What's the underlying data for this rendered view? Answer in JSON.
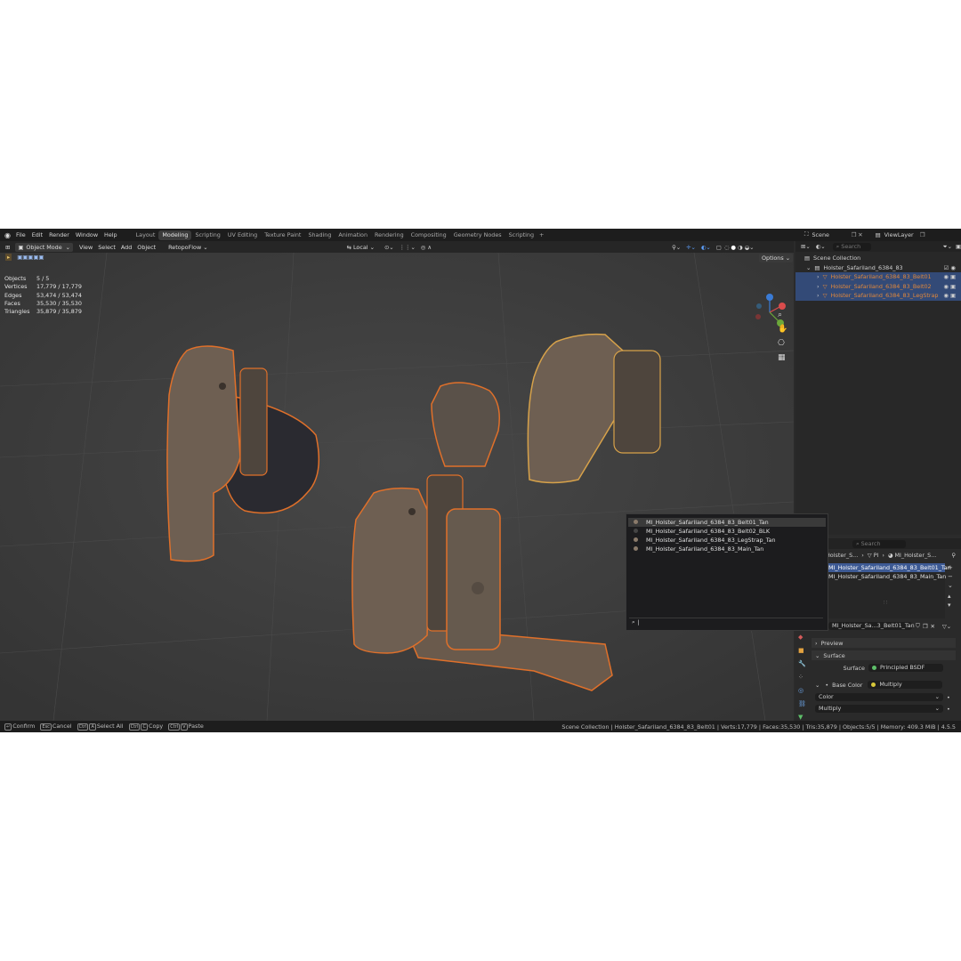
{
  "menu": [
    "File",
    "Edit",
    "Render",
    "Window",
    "Help"
  ],
  "workspaces": [
    "Layout",
    "Modeling",
    "Scripting",
    "UV Editing",
    "Texture Paint",
    "Shading",
    "Animation",
    "Rendering",
    "Compositing",
    "Geometry Nodes",
    "Scripting"
  ],
  "active_workspace": "Modeling",
  "scene_label": "Scene",
  "view_layer_label": "ViewLayer",
  "viewport_header": {
    "mode": "Object Mode",
    "menus": [
      "View",
      "Select",
      "Add",
      "Object"
    ],
    "addon": "RetopoFlow",
    "transform_space": "Local",
    "options": "Options"
  },
  "stats": {
    "objects_label": "Objects",
    "objects": "5 / 5",
    "vertices_label": "Vertices",
    "vertices": "17,779 / 17,779",
    "edges_label": "Edges",
    "edges": "53,474 / 53,474",
    "faces_label": "Faces",
    "faces": "35,530 / 35,530",
    "triangles_label": "Triangles",
    "triangles": "35,879 / 35,879"
  },
  "outliner": {
    "search_placeholder": "Search",
    "scene_collection": "Scene Collection",
    "collection": "Holster_Safariland_6384_83",
    "objects": [
      "Holster_Safariland_6384_83_Belt01",
      "Holster_Safariland_6384_83_Belt02",
      "Holster_Safariland_6384_83_LegStrap"
    ]
  },
  "material_popup": {
    "items": [
      "MI_Holster_Safariland_6384_83_Belt01_Tan",
      "MI_Holster_Safariland_6384_83_Belt02_BLK",
      "MI_Holster_Safariland_6384_83_LegStrap_Tan",
      "MI_Holster_Safariland_6384_83_Main_Tan"
    ]
  },
  "properties": {
    "search_placeholder": "Search",
    "breadcrumb_obj": "Holster_S...",
    "breadcrumb_mesh": "Pl",
    "breadcrumb_mat": "MI_Holster_S...",
    "slots": [
      "MI_Holster_Safariland_6384_83_Belt01_Tan",
      "MI_Holster_Safariland_6384_83_Main_Tan"
    ],
    "material_name": "MI_Holster_Sa...3_Belt01_Tan",
    "preview_label": "Preview",
    "surface_panel": "Surface",
    "surface_label": "Surface",
    "surface_value": "Principled BSDF",
    "base_color_label": "Base Color",
    "base_color_value": "Multiply",
    "color_value": "Color",
    "multiply_value": "Multiply"
  },
  "statusbar": {
    "confirm": "Confirm",
    "cancel_key": "Esc",
    "cancel": "Cancel",
    "select_all": "Select All",
    "copy": "Copy",
    "paste": "Paste",
    "info": "Scene Collection | Holster_Safariland_6384_83_Belt01 | Verts:17,779 | Faces:35,530 | Tris:35,879 | Objects:5/5 | Memory: 409.3 MiB | 4.5.5"
  },
  "colors": {
    "selected_outline": "#e0702a",
    "holster": "#6e5f52",
    "accent": "#334a77",
    "orange_text": "#e0883c"
  }
}
